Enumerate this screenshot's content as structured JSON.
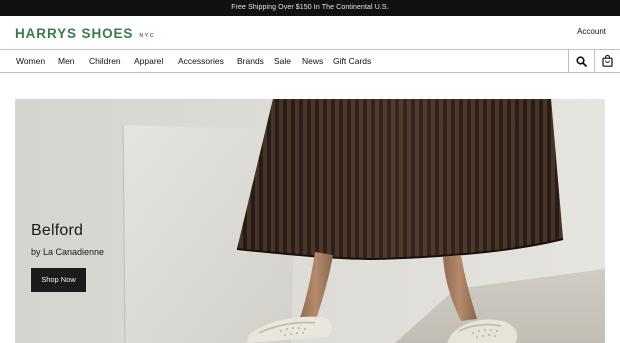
{
  "promo": {
    "text": "Free Shipping Over $150 In The Continental U.S."
  },
  "header": {
    "logo_main": "HARRYS SHOES",
    "logo_sub": "NYC",
    "account_label": "Account"
  },
  "nav": {
    "items": [
      {
        "label": "Women"
      },
      {
        "label": "Men"
      },
      {
        "label": "Children"
      },
      {
        "label": "Apparel"
      },
      {
        "label": "Accessories"
      },
      {
        "label": "Brands"
      },
      {
        "label": "Sale"
      },
      {
        "label": "News"
      },
      {
        "label": "Gift Cards"
      }
    ],
    "icons": [
      "search-icon",
      "shopping-bag-icon"
    ]
  },
  "hero": {
    "title": "Belford",
    "subtitle": "by La Canadienne",
    "button_label": "Shop Now"
  },
  "colors": {
    "brand_green": "#3d7a4d",
    "promo_bg": "#111111",
    "button_bg": "#1b1b1b",
    "skirt": "#3b2a22"
  }
}
